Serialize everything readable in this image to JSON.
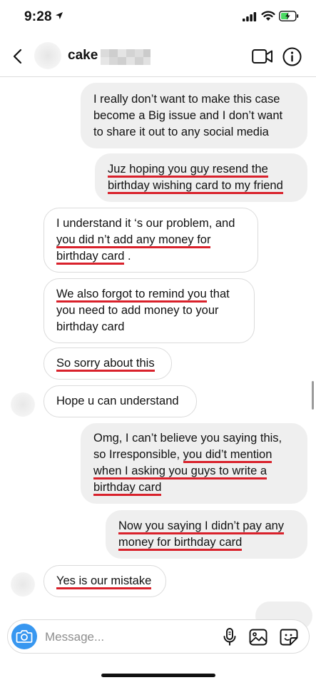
{
  "status_bar": {
    "time": "9:28"
  },
  "header": {
    "name": "cake"
  },
  "messages": [
    {
      "side": "sent",
      "lines": [
        [
          "I really don’t want to make this case"
        ],
        [
          "become a Big issue and I don’t want"
        ],
        [
          "to share it out to any social media"
        ]
      ]
    },
    {
      "side": "sent",
      "lines": [
        [
          "Juz hoping you guy resend the"
        ],
        [
          "birthday wishing card to my friend"
        ]
      ]
    },
    {
      "side": "recv",
      "lines": [
        [
          "I understand it ‘s our problem, and"
        ],
        [
          "you did n’t add any money for"
        ],
        [
          "birthday card",
          " ."
        ]
      ]
    },
    {
      "side": "recv",
      "lines": [
        [
          "We also forgot to remind you",
          " that"
        ],
        [
          "you need to add money to your"
        ],
        [
          "birthday card"
        ]
      ]
    },
    {
      "side": "recv",
      "lines": [
        [
          "So sorry about this"
        ]
      ]
    },
    {
      "side": "recv",
      "lines": [
        [
          "Hope u can understand"
        ]
      ]
    },
    {
      "side": "sent",
      "lines": [
        [
          "Omg, I can’t believe you saying this,"
        ],
        [
          "so Irresponsible, ",
          "you did’t mention"
        ],
        [
          "when I asking you guys to write a"
        ],
        [
          "birthday card"
        ]
      ]
    },
    {
      "side": "sent",
      "lines": [
        [
          "Now you saying I didn’t pay any"
        ],
        [
          "money for birthday card"
        ]
      ]
    },
    {
      "side": "recv",
      "lines": [
        [
          "Yes is our mistake"
        ]
      ]
    }
  ],
  "composer": {
    "placeholder": "Message..."
  },
  "icons": {
    "back": "chevron-left-icon",
    "video": "video-camera-icon",
    "info": "info-icon",
    "camera": "camera-icon",
    "mic": "microphone-icon",
    "gallery": "gallery-icon",
    "sticker": "sticker-icon"
  },
  "colors": {
    "underline": "#d9212b",
    "sent_bubble": "#efefef",
    "received_border": "#dbdbdb",
    "camera_button": "#3897f0"
  }
}
